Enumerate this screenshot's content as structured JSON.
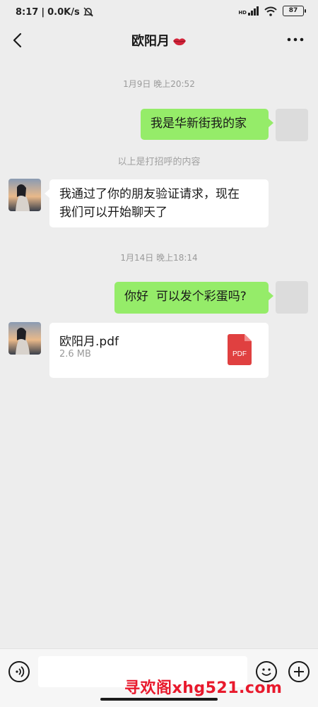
{
  "status": {
    "time": "8:17",
    "speed": "0.0K/s",
    "battery": "87",
    "signal": "HD"
  },
  "header": {
    "title": "欧阳月"
  },
  "messages": {
    "ts1": "1月9日 晚上20:52",
    "msg1": "我是华新街我的家",
    "system": "以上是打招呼的内容",
    "msg2_line1": "我通过了你的朋友验证请求，现在",
    "msg2_line2": "我们可以开始聊天了",
    "ts2": "1月14日 晚上18:14",
    "msg3": "你好  可以发个彩蛋吗?",
    "file_name": "欧阳月.pdf",
    "file_size": "2.6 MB",
    "file_icon_label": "PDF"
  },
  "input": {
    "value": ""
  },
  "watermark": "寻欢阁xhg521.com",
  "colors": {
    "my_bubble": "#95ec69",
    "their_bubble": "#ffffff",
    "background": "#ededed",
    "pdf_red": "#e04040"
  }
}
